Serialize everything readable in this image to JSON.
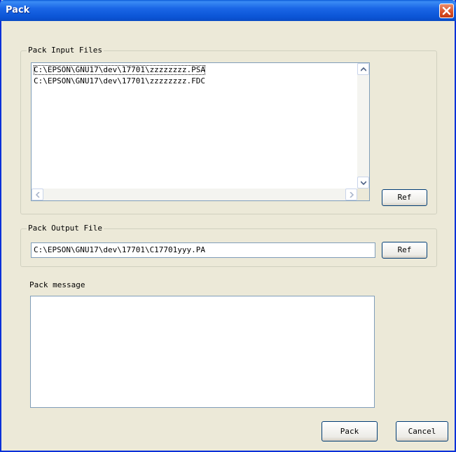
{
  "window": {
    "title": "Pack"
  },
  "input_group": {
    "label": "Pack Input Files",
    "files": [
      "C:\\EPSON\\GNU17\\dev\\17701\\zzzzzzzz.PSA",
      "C:\\EPSON\\GNU17\\dev\\17701\\zzzzzzzz.FDC"
    ],
    "ref_label": "Ref"
  },
  "output_group": {
    "label": "Pack Output File",
    "path": "C:\\EPSON\\GNU17\\dev\\17701\\C17701yyy.PA",
    "ref_label": "Ref"
  },
  "message": {
    "label": "Pack message",
    "text": ""
  },
  "buttons": {
    "pack": "Pack",
    "cancel": "Cancel"
  },
  "icons": {
    "close": "close-icon",
    "scroll_up": "arrow-up-icon",
    "scroll_down": "arrow-down-icon",
    "scroll_left": "arrow-left-icon",
    "scroll_right": "arrow-right-icon"
  }
}
